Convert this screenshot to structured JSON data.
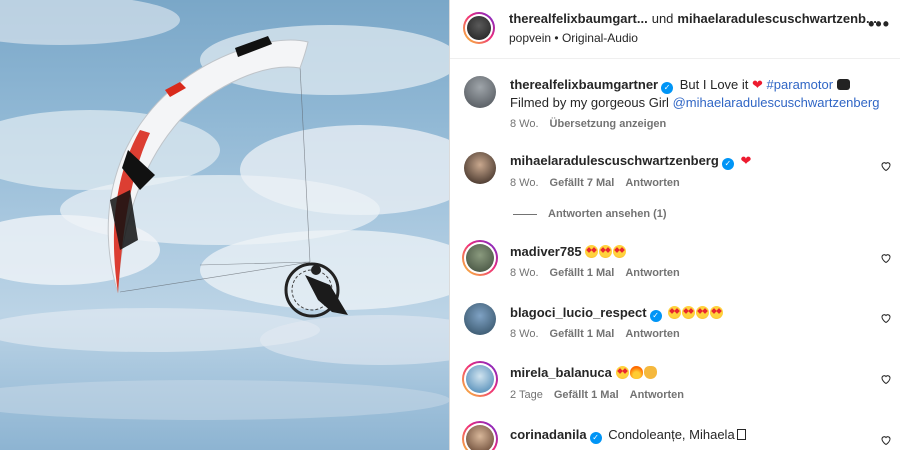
{
  "header": {
    "user1": "therealfelixbaumgart...",
    "conj": "und",
    "user2": "mihaelaradulescuschwartzenb...",
    "sub_account": "popvein",
    "sub_sep": "•",
    "sub_audio": "Original-Audio",
    "more": "•••"
  },
  "caption": {
    "username": "therealfelixbaumgartner",
    "text1": "But I Love it",
    "hashtag": "#paramotor",
    "text2": "Filmed by my gorgeous Girl",
    "mention": "@mihaelaradulescuschwartzenberg",
    "age": "8 Wo.",
    "translate": "Übersetzung anzeigen"
  },
  "comments": [
    {
      "username": "mihaelaradulescuschwartzenberg",
      "verified": true,
      "age": "8 Wo.",
      "likes": "Gefällt 7 Mal",
      "reply": "Antworten",
      "view_replies": "Antworten ansehen (1)"
    },
    {
      "username": "madiver785",
      "verified": false,
      "age": "8 Wo.",
      "likes": "Gefällt 1 Mal",
      "reply": "Antworten"
    },
    {
      "username": "blagoci_lucio_respect",
      "verified": true,
      "age": "8 Wo.",
      "likes": "Gefällt 1 Mal",
      "reply": "Antworten"
    },
    {
      "username": "mirela_balanuca",
      "verified": false,
      "age": "2 Tage",
      "likes": "Gefällt 1 Mal",
      "reply": "Antworten"
    },
    {
      "username": "corinadanila",
      "verified": true,
      "text": "Condoleanțe, Mihaela"
    }
  ],
  "icons": {
    "verified": "✓",
    "heart": "❤"
  },
  "colors": {
    "link": "#00376b",
    "hashtag": "#3066c5",
    "verified": "#0095f6",
    "meta": "#737373"
  }
}
